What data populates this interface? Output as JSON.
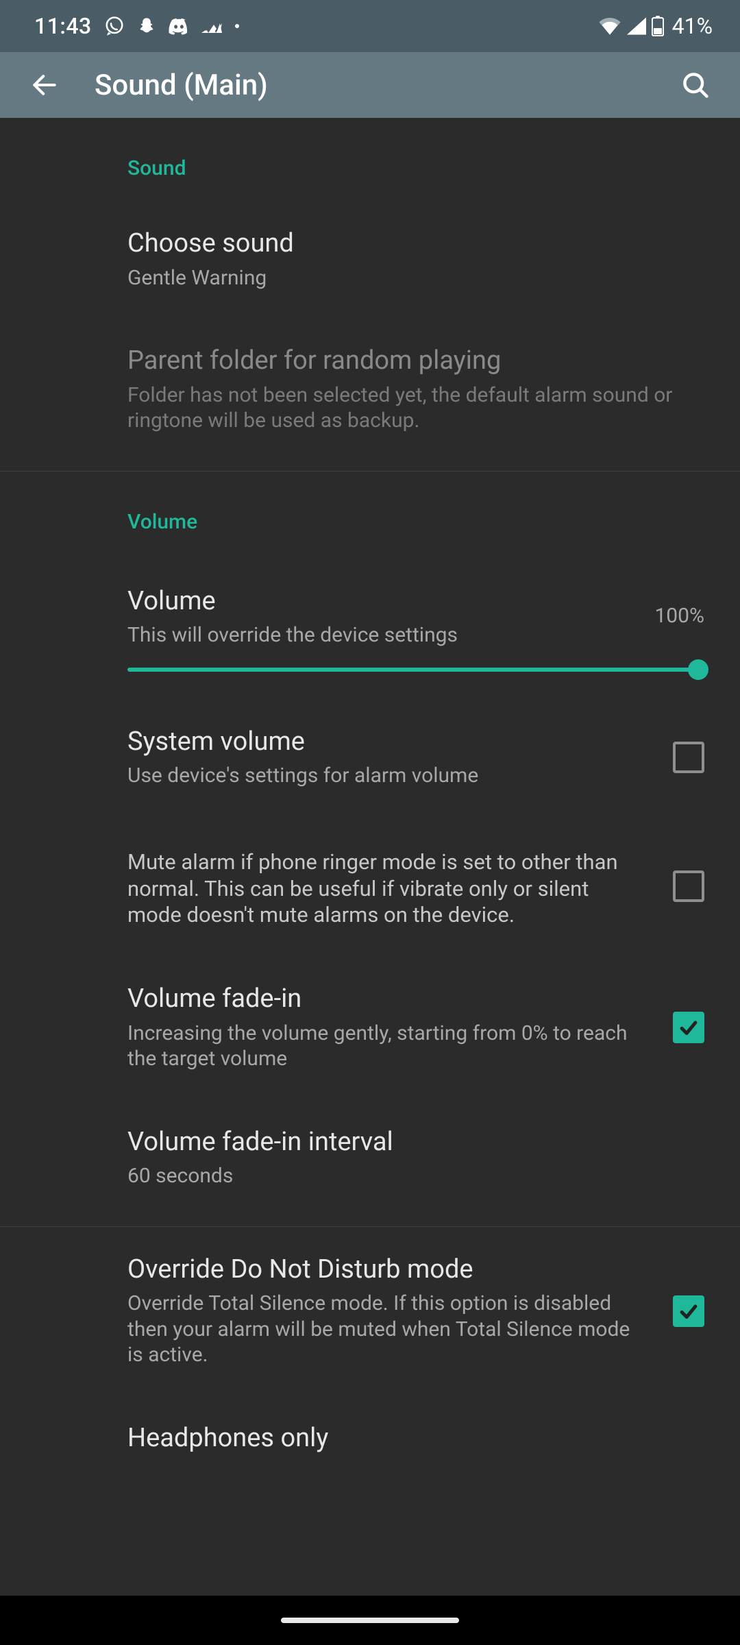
{
  "status": {
    "time": "11:43",
    "battery": "41%"
  },
  "appbar": {
    "title": "Sound (Main)"
  },
  "sections": {
    "sound": {
      "header": "Sound",
      "choose": {
        "title": "Choose sound",
        "sub": "Gentle Warning"
      },
      "parent_folder": {
        "title": "Parent folder for random playing",
        "sub": "Folder has not been selected yet, the default alarm sound or ringtone will be used as backup."
      }
    },
    "volume": {
      "header": "Volume",
      "volume": {
        "title": "Volume",
        "sub": "This will override the device settings",
        "pct": "100%"
      },
      "system_volume": {
        "title": "System volume",
        "sub": "Use device's settings for alarm volume"
      },
      "mute_ringer": {
        "sub": "Mute alarm if phone ringer mode is set to other than normal. This can be useful if vibrate only or silent mode doesn't mute alarms on the device."
      },
      "fade_in": {
        "title": "Volume fade-in",
        "sub": "Increasing the volume gently, starting from 0% to reach the target volume"
      },
      "fade_interval": {
        "title": "Volume fade-in interval",
        "sub": "60 seconds"
      }
    },
    "dnd": {
      "override": {
        "title": "Override Do Not Disturb mode",
        "sub": "Override Total Silence mode. If this option is disabled then your alarm will be muted when Total Silence mode is active."
      },
      "headphones": {
        "title": "Headphones only"
      }
    }
  },
  "colors": {
    "accent": "#1fb89a"
  }
}
